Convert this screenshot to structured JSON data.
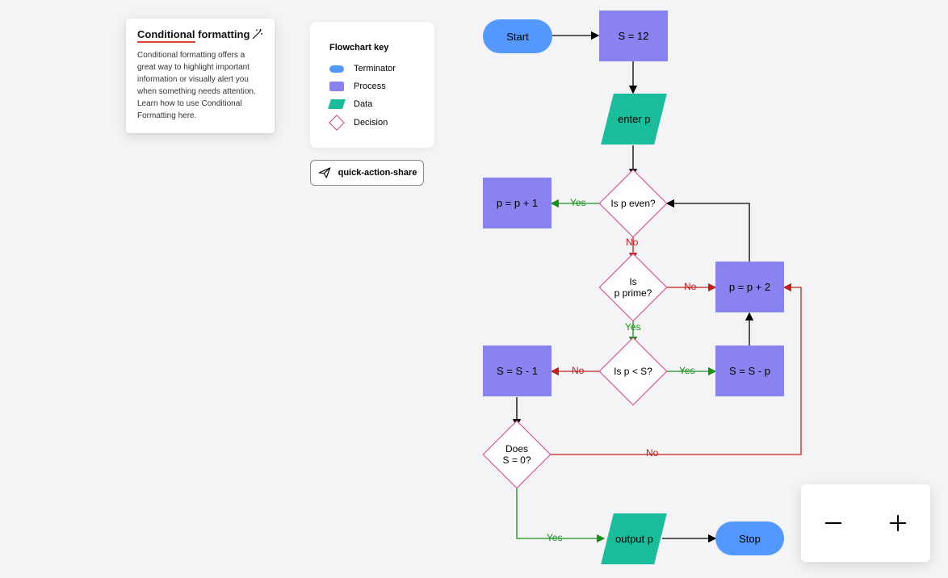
{
  "tooltip": {
    "title_underlined": "Conditional",
    "title_rest": " formatting",
    "body": "Conditional formatting offers a great way to highlight important information or visually alert you when something needs attention. Learn how to use Conditional Formatting here."
  },
  "legend": {
    "title": "Flowchart key",
    "items": [
      "Terminator",
      "Process",
      "Data",
      "Decision"
    ]
  },
  "quick_action": {
    "label": "quick-action-share"
  },
  "nodes": {
    "start": "Start",
    "init_s": "S = 12",
    "enter_p": "enter p",
    "is_p_even": "Is p even?",
    "p_plus_1": "p = p + 1",
    "is_p_prime_l1": "Is",
    "is_p_prime_l2": "p prime?",
    "p_plus_2": "p = p + 2",
    "is_p_lt_s": "Is p < S?",
    "s_minus_p": "S = S - p",
    "s_minus_1": "S = S - 1",
    "does_s_0_l1": "Does",
    "does_s_0_l2": "S = 0?",
    "output_p": "output p",
    "stop": "Stop"
  },
  "edge_labels": {
    "yes1": "Yes",
    "no1": "No",
    "no2": "No",
    "yes2": "Yes",
    "no3": "No",
    "yes3": "Yes",
    "no4": "No",
    "yes4": "Yes"
  }
}
